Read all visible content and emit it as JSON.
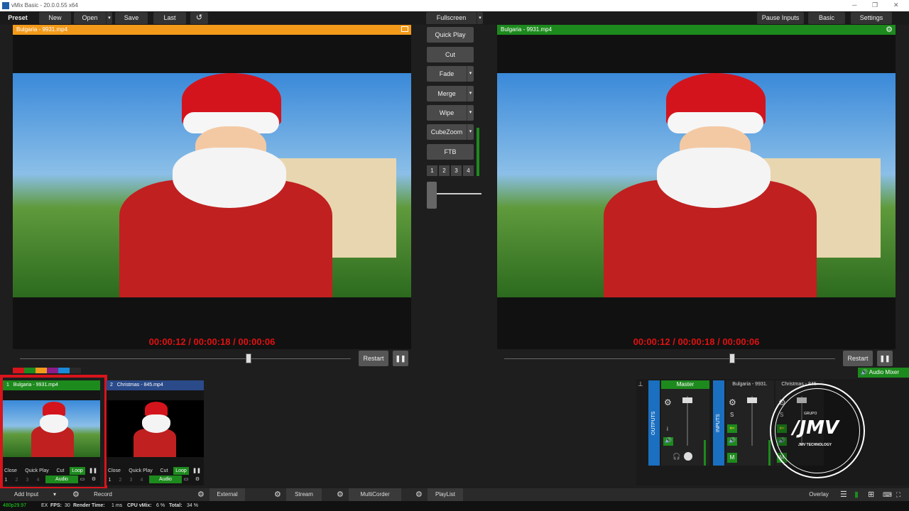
{
  "window": {
    "title": "vMix Basic - 20.0.0.55 x64",
    "controls": [
      "─",
      "❐",
      "✕"
    ]
  },
  "toolbar": {
    "preset": "Preset",
    "new": "New",
    "open": "Open",
    "save": "Save",
    "last": "Last",
    "fullscreen": "Fullscreen",
    "pause_inputs": "Pause Inputs",
    "basic": "Basic",
    "settings": "Settings"
  },
  "preview": {
    "title": "Bulgaria - 9931.mp4",
    "timer": "00:00:12  /  00:00:18  /  00:00:06",
    "restart": "Restart",
    "header_color": "#f39a1a",
    "position": 0.72
  },
  "output": {
    "title": "Bulgaria - 9931.mp4",
    "timer": "00:00:12  /  00:00:18  /  00:00:06",
    "restart": "Restart",
    "header_color": "#1d8a1d",
    "position": 0.69
  },
  "transitions": {
    "quick_play": "Quick Play",
    "cut": "Cut",
    "fade": "Fade",
    "merge": "Merge",
    "wipe": "Wipe",
    "cubezoom": "CubeZoom",
    "ftb": "FTB",
    "numbers": [
      "1",
      "2",
      "3",
      "4"
    ]
  },
  "inputs": [
    {
      "number": "1",
      "name": "Bulgaria - 9931.mp4",
      "close": "Close",
      "quick_play": "Quick Play",
      "cut": "Cut",
      "loop": "Loop",
      "audio": "Audio",
      "layers": [
        "1",
        "2",
        "3",
        "4"
      ],
      "header_color": "#1d8a1d"
    },
    {
      "number": "2",
      "name": "Christmas - 845.mp4",
      "close": "Close",
      "quick_play": "Quick Play",
      "cut": "Cut",
      "loop": "Loop",
      "audio": "Audio",
      "layers": [
        "1",
        "2",
        "3",
        "4"
      ],
      "header_color": "#2a4a8a"
    }
  ],
  "audio_mixer": {
    "label": "Audio Mixer",
    "outputs_label": "OUTPUTS",
    "inputs_label": "INPUTS",
    "master": "Master",
    "i": "i",
    "m": "M",
    "s": "S",
    "ch1": "Bulgaria - 9931.",
    "ch2": "Christmas - 845."
  },
  "watermark": {
    "brand": "JMV TECHNOLOGY",
    "top": "GRUPO"
  },
  "bottombar": {
    "add_input": "Add Input",
    "record": "Record",
    "external": "External",
    "stream": "Stream",
    "multicorder": "MultiCorder",
    "playlist": "PlayList",
    "overlay": "Overlay"
  },
  "status": {
    "resolution": "480p29.97",
    "ex": "EX",
    "fps_label": "FPS:",
    "fps": "30",
    "render_label": "Render Time:",
    "render": "1 ms",
    "cpu_label": "CPU vMix:",
    "cpu": "6 %",
    "total_label": "Total:",
    "total": "34 %"
  },
  "colors": {
    "preview_header": "#f39a1a",
    "output_header": "#1d8a1d",
    "timer": "#e01010",
    "active_input": "#d8141c"
  }
}
